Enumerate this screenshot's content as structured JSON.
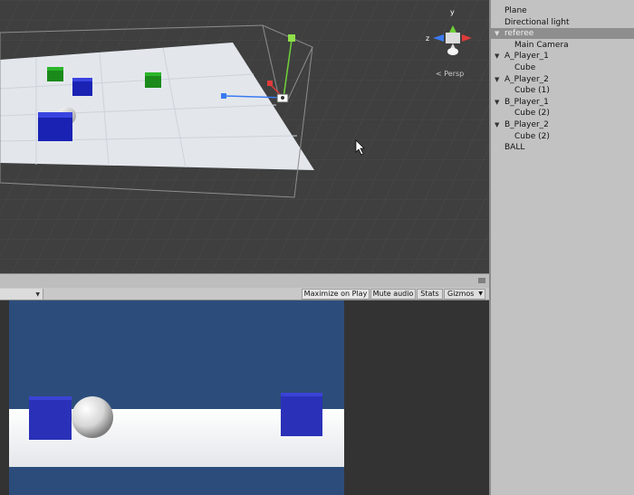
{
  "scene": {
    "persp_label": "Persp",
    "gizmo_axes": {
      "y": "y",
      "z": "z"
    }
  },
  "game_toolbar": {
    "buttons": [
      {
        "label": "Maximize on Play",
        "active": true
      },
      {
        "label": "Mute audio",
        "active": false
      },
      {
        "label": "Stats",
        "active": false
      },
      {
        "label": "Gizmos",
        "active": false
      }
    ]
  },
  "hierarchy": {
    "items": [
      {
        "label": "Plane",
        "depth": 0,
        "expanded": null,
        "selected": false
      },
      {
        "label": "Directional light",
        "depth": 0,
        "expanded": null,
        "selected": false
      },
      {
        "label": "referee",
        "depth": 0,
        "expanded": true,
        "selected": true
      },
      {
        "label": "Main Camera",
        "depth": 1,
        "expanded": null,
        "selected": false
      },
      {
        "label": "A_Player_1",
        "depth": 0,
        "expanded": true,
        "selected": false
      },
      {
        "label": "Cube",
        "depth": 1,
        "expanded": null,
        "selected": false
      },
      {
        "label": "A_Player_2",
        "depth": 0,
        "expanded": true,
        "selected": false
      },
      {
        "label": "Cube (1)",
        "depth": 1,
        "expanded": null,
        "selected": false
      },
      {
        "label": "B_Player_1",
        "depth": 0,
        "expanded": true,
        "selected": false
      },
      {
        "label": "Cube (2)",
        "depth": 1,
        "expanded": null,
        "selected": false
      },
      {
        "label": "B_Player_2",
        "depth": 0,
        "expanded": true,
        "selected": false
      },
      {
        "label": "Cube (2)",
        "depth": 1,
        "expanded": null,
        "selected": false
      },
      {
        "label": "BALL",
        "depth": 0,
        "expanded": null,
        "selected": false
      }
    ]
  },
  "colors": {
    "team_a": "#1a22b4",
    "team_b_scene": "#1e8a1e",
    "sky": "#2c4d7b",
    "selection": "#8e8e8e"
  }
}
